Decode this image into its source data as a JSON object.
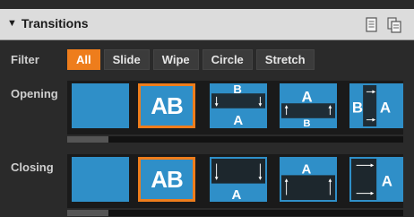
{
  "panel": {
    "title": "Transitions",
    "icons": [
      "copy-icon",
      "paste-icon"
    ]
  },
  "filter": {
    "label": "Filter",
    "options": [
      "All",
      "Slide",
      "Wipe",
      "Circle",
      "Stretch"
    ],
    "selected": "All"
  },
  "sections": [
    {
      "label": "Opening",
      "thumb_text": "AB",
      "selected_index": 1
    },
    {
      "label": "Closing",
      "thumb_text": "AB",
      "selected_index": 1
    }
  ],
  "colors": {
    "accent": "#ee7d1c",
    "thumb_blue": "#2f8fc8",
    "header_bg": "#dcdcdc"
  }
}
